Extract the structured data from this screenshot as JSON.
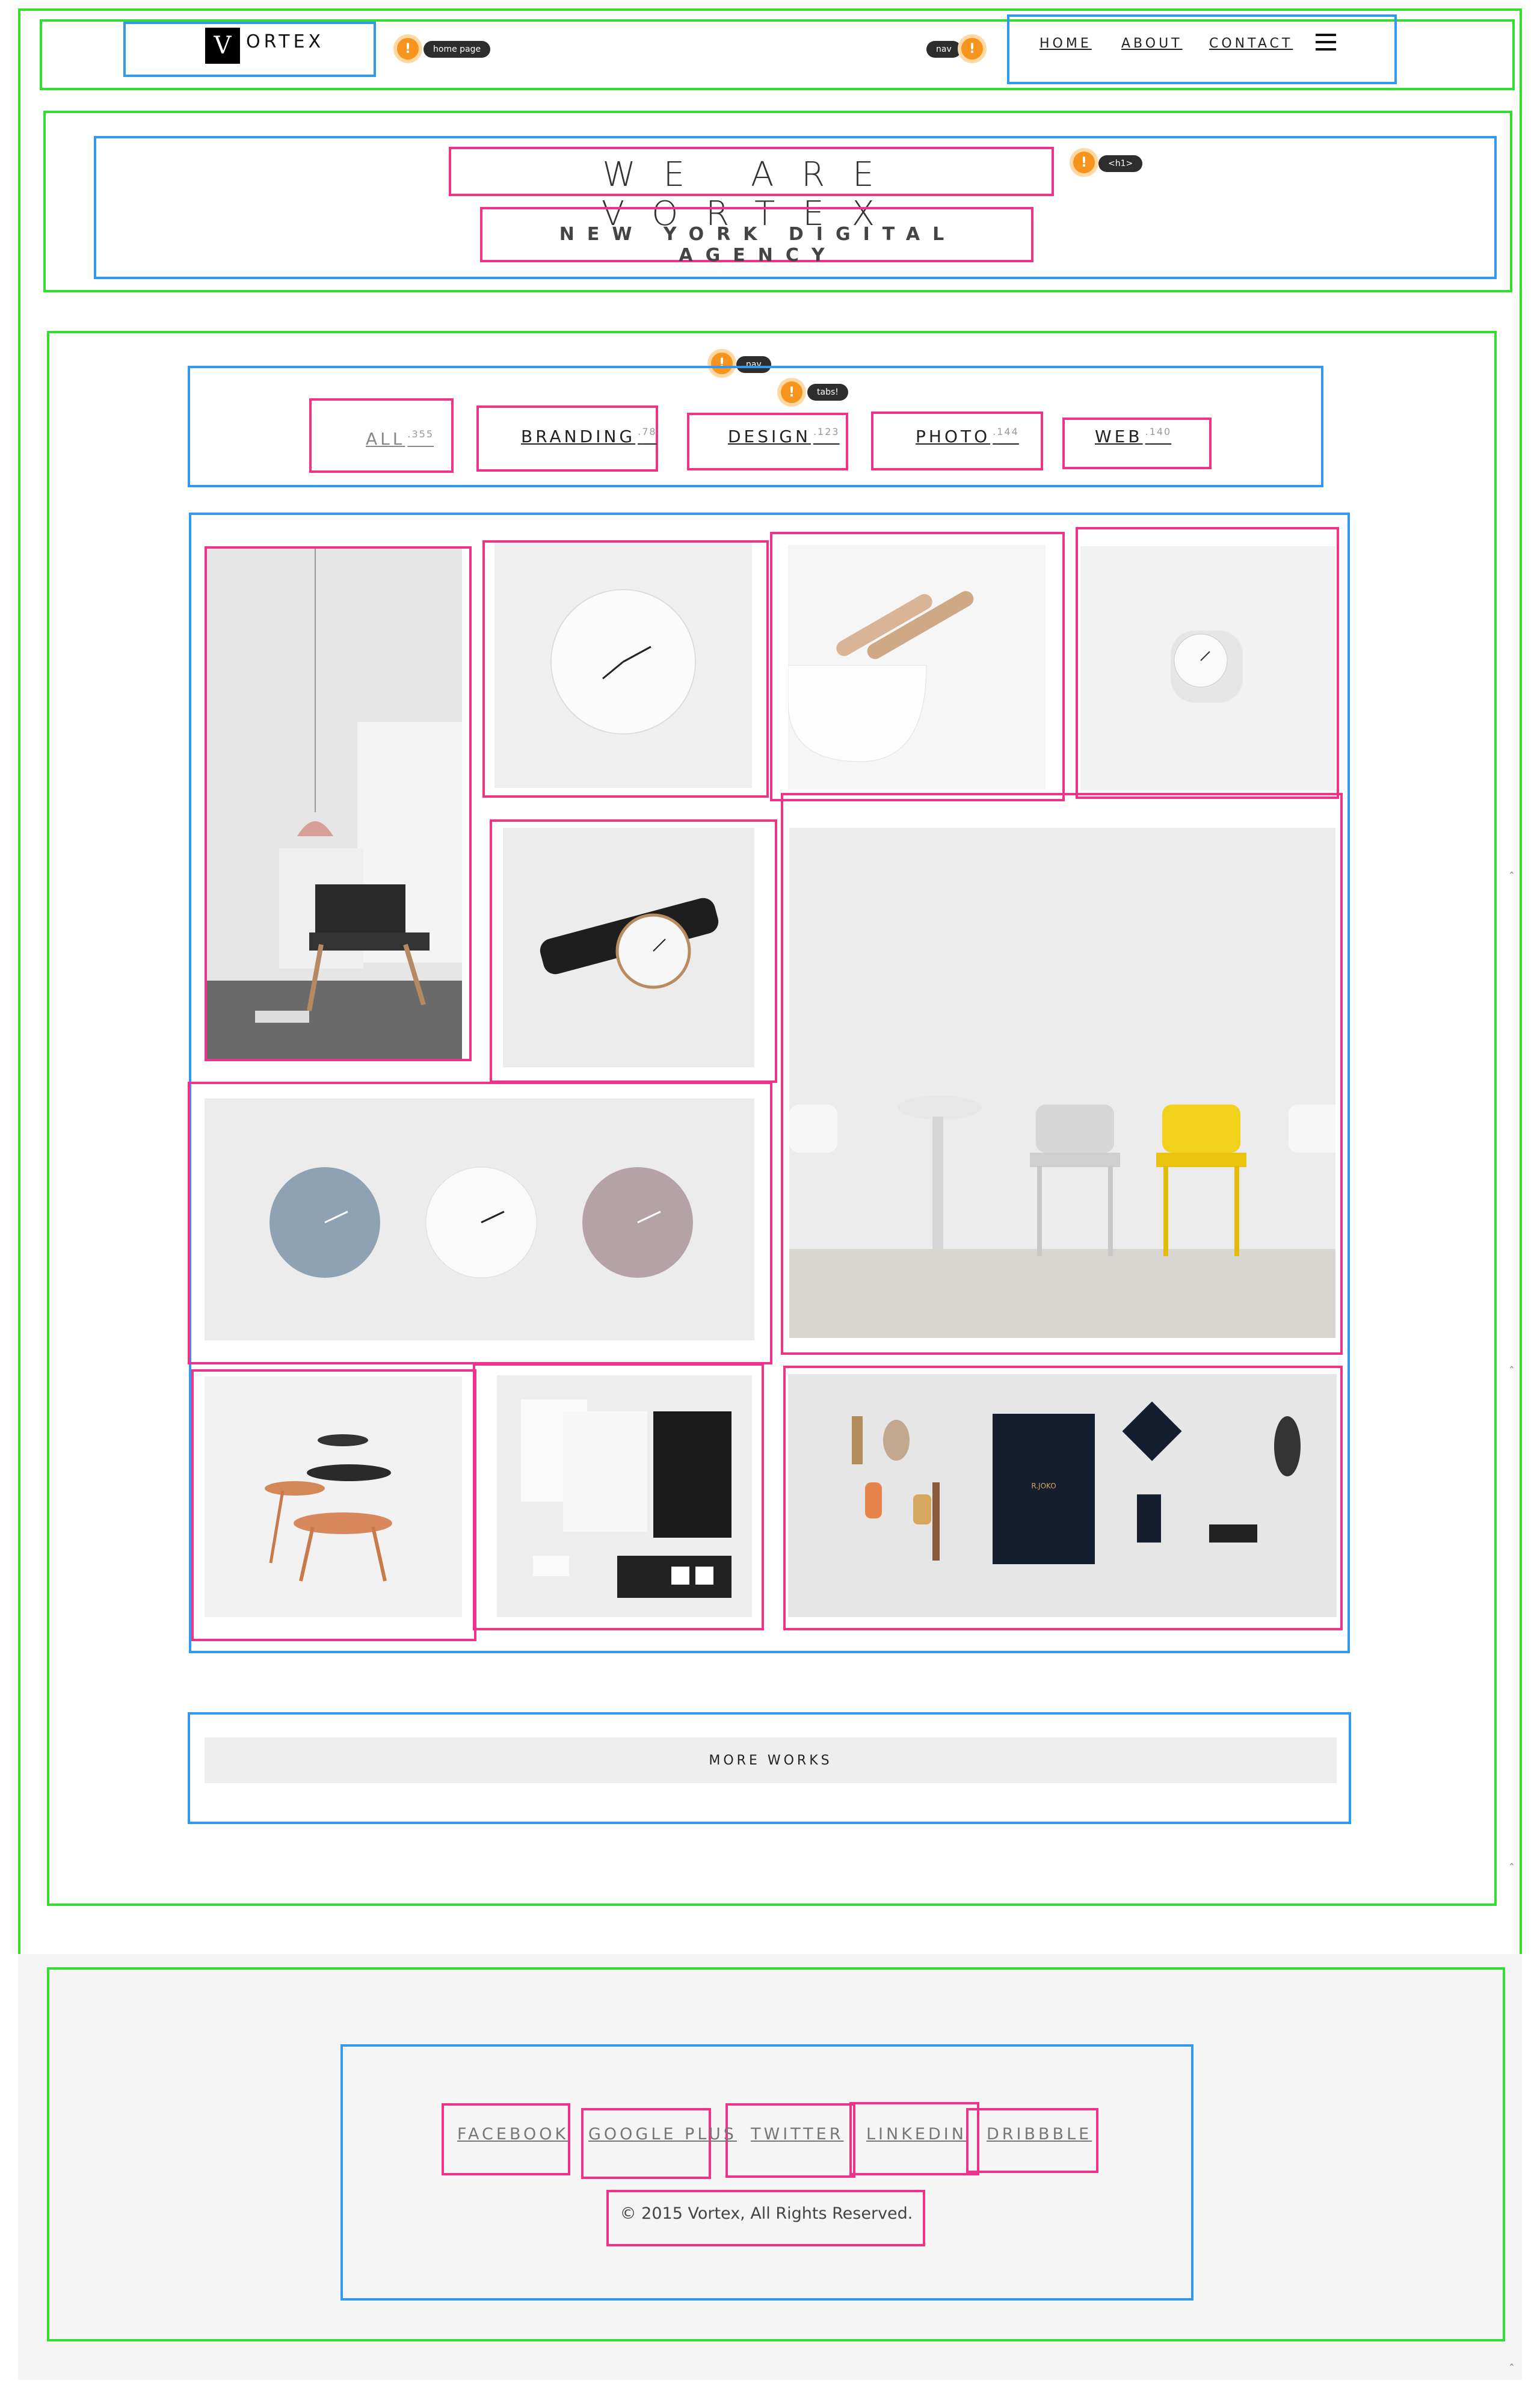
{
  "brand": {
    "mark": "V",
    "name": "ORTEX"
  },
  "nav": {
    "items": [
      "HOME",
      "ABOUT",
      "CONTACT"
    ],
    "menu_icon": "hamburger-icon"
  },
  "badges": {
    "home": "home page",
    "nav": "nav",
    "h1": "<h1>",
    "filters_nav": "nav",
    "tabs": "tabs!",
    "icon": "!"
  },
  "hero": {
    "title": "WE ARE VORTEX",
    "subtitle": "NEW YORK DIGITAL AGENCY"
  },
  "filters": [
    {
      "label": "ALL",
      "count": "355"
    },
    {
      "label": "BRANDING",
      "count": "78"
    },
    {
      "label": "DESIGN",
      "count": "123"
    },
    {
      "label": "PHOTO",
      "count": "144"
    },
    {
      "label": "WEB",
      "count": "140"
    }
  ],
  "gallery": {
    "items": [
      {
        "subject": "lounge chair with pendant lamp"
      },
      {
        "subject": "white wall clock"
      },
      {
        "subject": "bowl with wooden spoons"
      },
      {
        "subject": "desk clock"
      },
      {
        "subject": "wrist watch"
      },
      {
        "subject": "chairs against wall"
      },
      {
        "subject": "three wall clocks"
      },
      {
        "subject": "stacked side tables"
      },
      {
        "subject": "stationery mockup"
      },
      {
        "subject": "barber brand flatlay"
      }
    ],
    "flatlay_brand": "R.JOKO"
  },
  "more_works": {
    "label": "MORE WORKS"
  },
  "footer": {
    "social": [
      "FACEBOOK",
      "GOOGLE PLUS",
      "TWITTER",
      "LINKEDIN",
      "DRIBBBLE"
    ],
    "copyright": "© 2015 Vortex, All Rights Reserved."
  },
  "colors": {
    "annotation_green": "#33dd33",
    "annotation_blue": "#3399ee",
    "annotation_pink": "#ee3388",
    "badge_orange": "#f7941d",
    "accent_yellow": "#f2d11c"
  }
}
